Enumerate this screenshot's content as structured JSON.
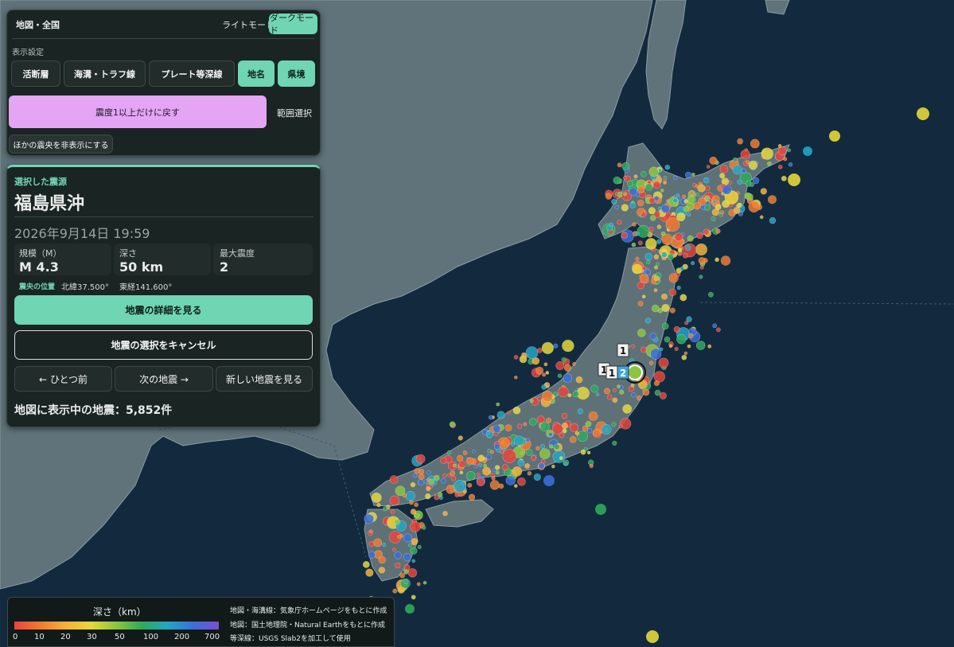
{
  "header": {
    "title": "地図・全国",
    "light_mode": "ライトモード",
    "dark_mode": "ダークモード"
  },
  "display_settings": {
    "label": "表示設定",
    "layers": [
      "活断層",
      "海溝・トラフ線",
      "プレート等深線",
      "地名",
      "県境"
    ],
    "active_layers": [
      "地名",
      "県境"
    ],
    "reset_button": "震度1以上だけに戻す",
    "range_select": "範囲選択",
    "hide_others": "ほかの震央を非表示にする"
  },
  "selected": {
    "section_label": "選択した震源",
    "place": "福島県沖",
    "datetime": "2026年9月14日 19:59",
    "stats": [
      {
        "label": "規模（M）",
        "value": "M 4.3"
      },
      {
        "label": "深さ",
        "value": "50 km"
      },
      {
        "label": "最大震度",
        "value": "2"
      }
    ],
    "epicenter_label": "震央の位置",
    "lat": "北緯37.500°",
    "lon": "東経141.600°",
    "detail_button": "地震の詳細を見る",
    "cancel_button": "地震の選択をキャンセル",
    "prev": "← ひとつ前",
    "next": "次の地震 →",
    "newest": "新しい地震を見る",
    "count_text": "地図に表示中の地震：5,852件"
  },
  "legend": {
    "title": "深さ（km）",
    "ticks": [
      "0",
      "10",
      "20",
      "30",
      "50",
      "100",
      "200",
      "700"
    ],
    "colors": [
      "#e8453c",
      "#f07a2e",
      "#f4b23a",
      "#e6d73a",
      "#8bc63f",
      "#2faa5a",
      "#22a6c6",
      "#3a6fd8",
      "#7b4fd0"
    ],
    "credits": [
      "地図・海溝線：気象庁ホームページをもとに作成",
      "地図：国土地理院・Natural Earthをもとに作成",
      "等深線：USGS Slab2を加工して使用"
    ]
  },
  "map_badges": [
    "1",
    "1",
    "1",
    "2"
  ],
  "colors": {
    "accent": "#6fd5b2",
    "reset": "#e4a5f5",
    "sea": "#132a3e",
    "land": "#60737a"
  }
}
